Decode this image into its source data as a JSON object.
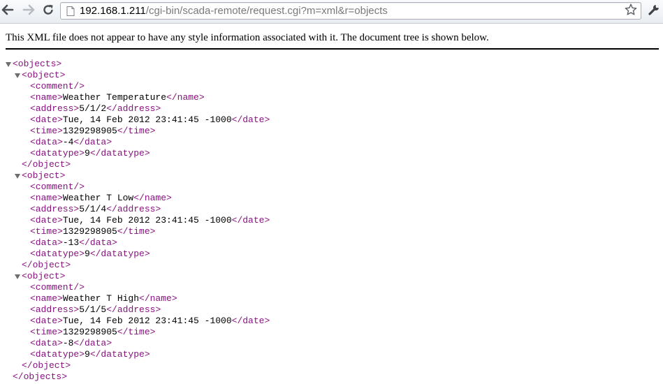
{
  "browser": {
    "url_host": "192.168.1.211",
    "url_path": "/cgi-bin/scada-remote/request.cgi?m=xml&r=objects",
    "icons": {
      "back": "back-arrow-icon",
      "forward": "forward-arrow-icon",
      "reload": "reload-icon",
      "page": "page-icon",
      "bookmark": "star-icon",
      "menu": "wrench-icon"
    }
  },
  "xml_viewer": {
    "notice": "This XML file does not appear to have any style information associated with it. The document tree is shown below.",
    "root_open": "<objects>",
    "root_close": "</objects>",
    "object_open": "<object>",
    "object_close": "</object>",
    "comment_tag": "<comment/>",
    "objects": [
      {
        "name": "Weather Temperature",
        "address": "5/1/2",
        "date": "Tue, 14 Feb 2012 23:41:45 -1000",
        "time": "1329298905",
        "data": "-4",
        "datatype": "9"
      },
      {
        "name": "Weather T Low",
        "address": "5/1/4",
        "date": "Tue, 14 Feb 2012 23:41:45 -1000",
        "time": "1329298905",
        "data": "-13",
        "datatype": "9"
      },
      {
        "name": "Weather T High",
        "address": "5/1/5",
        "date": "Tue, 14 Feb 2012 23:41:45 -1000",
        "time": "1329298905",
        "data": "-8",
        "datatype": "9"
      }
    ]
  }
}
